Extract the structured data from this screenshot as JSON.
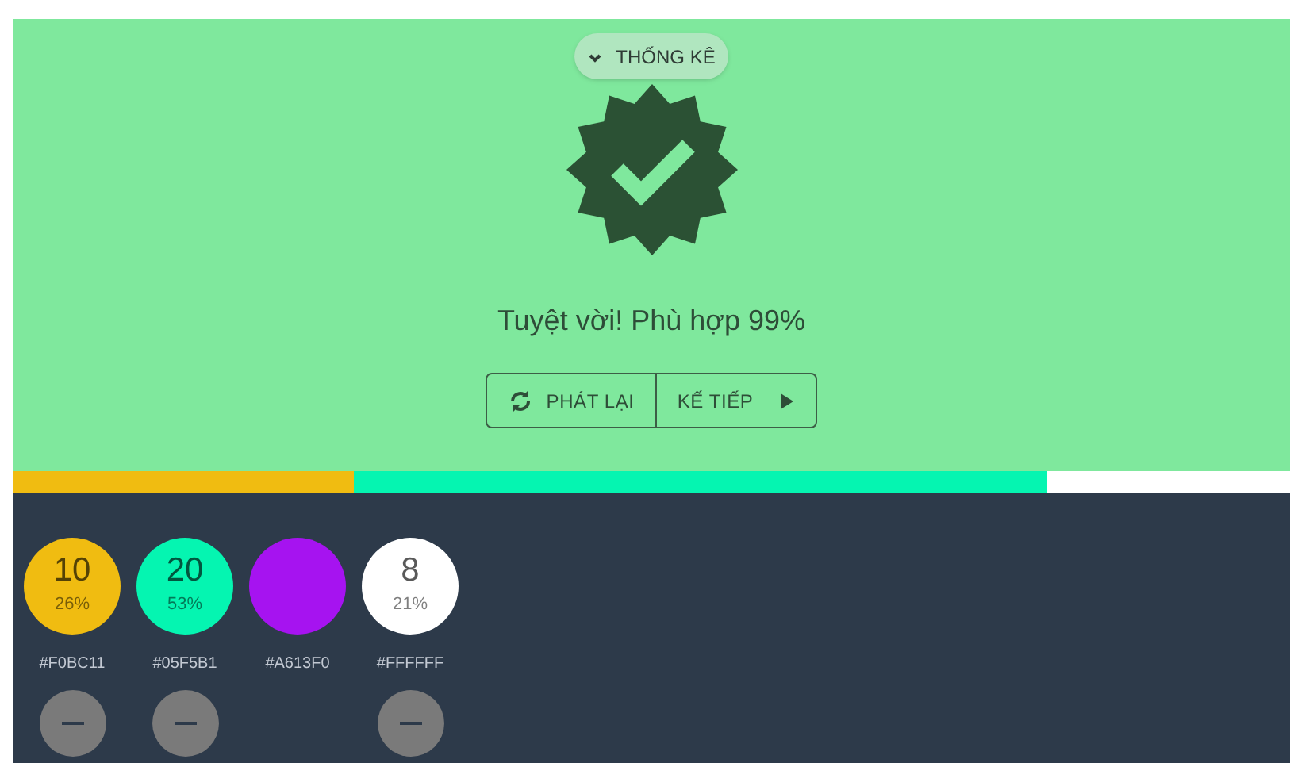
{
  "stats_toggle": {
    "label": "THỐNG KÊ",
    "expanded": false
  },
  "result": {
    "message": "Tuyệt vời! Phù hợp 99%"
  },
  "buttons": [
    {
      "kind": "replay",
      "label": "PHÁT LẠI"
    },
    {
      "kind": "next",
      "label": "KẾ TIẾP"
    }
  ],
  "bar": [
    {
      "color": "#f0bc11",
      "level": 0.267
    },
    {
      "color": "#05f5b1",
      "level": 0.81
    }
  ],
  "swatches": [
    {
      "color": "#f0bc11",
      "count": "10",
      "percent": "26%",
      "hex": "#F0BC11",
      "removable": true
    },
    {
      "color": "#05f5b1",
      "count": "20",
      "percent": "53%",
      "hex": "#05F5B1",
      "removable": true
    },
    {
      "color": "#a613f0",
      "hex": "#A613F0",
      "removable": false
    },
    {
      "color": "#ffffff",
      "count": "8",
      "percent": "21%",
      "hex": "#FFFFFF",
      "removable": true
    }
  ]
}
